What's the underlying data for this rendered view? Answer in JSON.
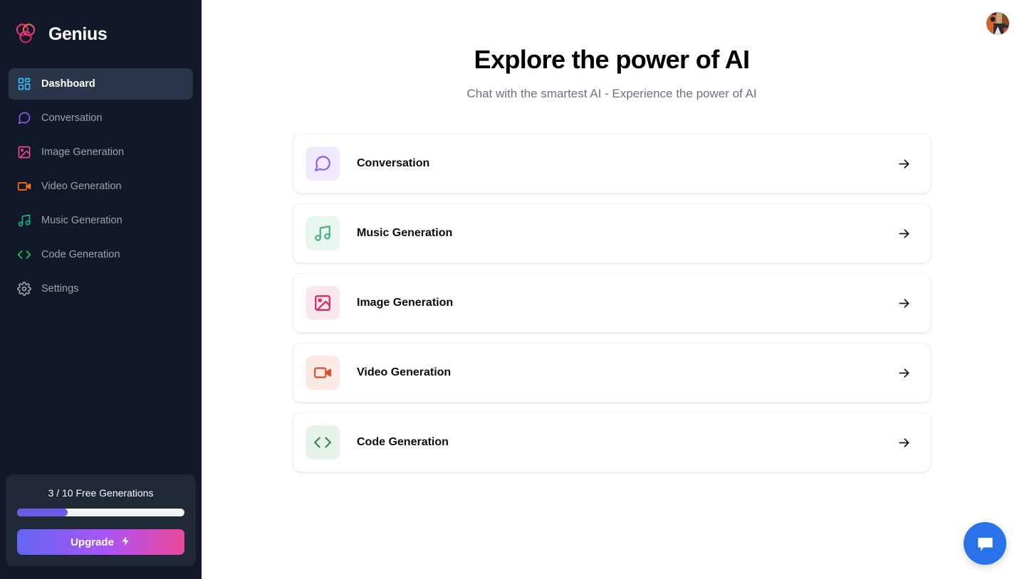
{
  "brand": {
    "name": "Genius",
    "logo_icon": "genius-circles-logo"
  },
  "sidebar": {
    "items": [
      {
        "label": "Dashboard",
        "icon": "layout-dashboard-icon",
        "color": "#38bdf8",
        "active": true
      },
      {
        "label": "Conversation",
        "icon": "message-square-icon",
        "color": "#8b5cf6",
        "active": false
      },
      {
        "label": "Image Generation",
        "icon": "image-icon",
        "color": "#ec4899",
        "active": false
      },
      {
        "label": "Video Generation",
        "icon": "video-icon",
        "color": "#f97316",
        "active": false
      },
      {
        "label": "Music Generation",
        "icon": "music-icon",
        "color": "#10b981",
        "active": false
      },
      {
        "label": "Code Generation",
        "icon": "code-icon",
        "color": "#22c55e",
        "active": false
      },
      {
        "label": "Settings",
        "icon": "settings-gear-icon",
        "color": "#9ca3af",
        "active": false
      }
    ],
    "free_counter": {
      "label": "3 / 10 Free Generations",
      "used": 3,
      "total": 10,
      "percent": 30,
      "fill_color": "#6c5ce7",
      "track_color": "#f4f4f5"
    },
    "upgrade_button": {
      "label": "Upgrade",
      "icon": "zap-bolt-icon"
    }
  },
  "topbar": {
    "avatar_icon": "user-avatar-photo"
  },
  "header": {
    "title": "Explore the power of AI",
    "subtitle": "Chat with the smartest AI - Experience the power of AI"
  },
  "tools": [
    {
      "label": "Conversation",
      "icon": "message-square-icon",
      "color": "#8b5cf6",
      "bg": "#f1eafe",
      "arrow": "arrow-right-icon"
    },
    {
      "label": "Music Generation",
      "icon": "music-icon",
      "color": "#4cae7f",
      "bg": "#e7f6ee",
      "arrow": "arrow-right-icon"
    },
    {
      "label": "Image Generation",
      "icon": "image-icon",
      "color": "#d0275e",
      "bg": "#fae6ee",
      "arrow": "arrow-right-icon"
    },
    {
      "label": "Video Generation",
      "icon": "video-icon",
      "color": "#d8502c",
      "bg": "#fbe9e4",
      "arrow": "arrow-right-icon"
    },
    {
      "label": "Code Generation",
      "icon": "code-icon",
      "color": "#2f8a4e",
      "bg": "#e6f3e9",
      "arrow": "arrow-right-icon"
    }
  ],
  "chat_widget": {
    "icon": "chat-bubble-icon",
    "color": "#2b72ea"
  }
}
